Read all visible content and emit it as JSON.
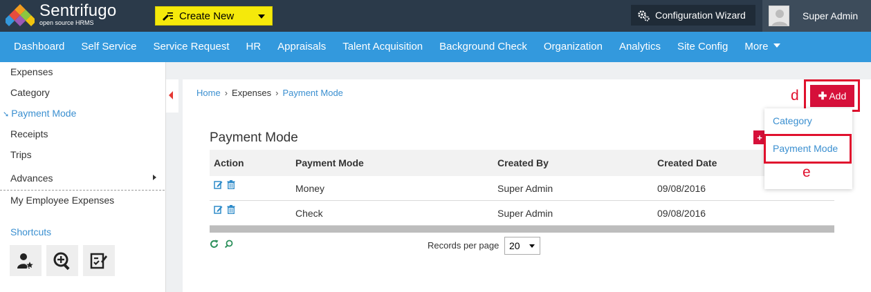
{
  "brand": {
    "name": "Sentrifugo",
    "subtitle": "open source HRMS"
  },
  "topbar": {
    "create_new_label": "Create New",
    "config_wizard_label": "Configuration Wizard",
    "user_name": "Super Admin"
  },
  "nav": {
    "items": [
      "Dashboard",
      "Self Service",
      "Service Request",
      "HR",
      "Appraisals",
      "Talent Acquisition",
      "Background Check",
      "Organization",
      "Analytics",
      "Site Config"
    ],
    "more_label": "More"
  },
  "sidebar": {
    "items": [
      {
        "label": "Expenses"
      },
      {
        "label": "Category"
      },
      {
        "label": "Payment Mode"
      },
      {
        "label": "Receipts"
      },
      {
        "label": "Trips"
      },
      {
        "label": "Advances"
      },
      {
        "label": "My Employee Expenses"
      }
    ],
    "shortcuts_label": "Shortcuts"
  },
  "breadcrumb": {
    "home": "Home",
    "section": "Expenses",
    "current": "Payment Mode",
    "separator": "›"
  },
  "page": {
    "heading": "Payment Mode"
  },
  "table": {
    "headers": [
      "Action",
      "Payment Mode",
      "Created By",
      "Created Date"
    ],
    "rows": [
      {
        "payment_mode": "Money",
        "created_by": "Super Admin",
        "created_date": "09/08/2016"
      },
      {
        "payment_mode": "Check",
        "created_by": "Super Admin",
        "created_date": "09/08/2016"
      }
    ]
  },
  "pagination": {
    "records_per_page_label": "Records per page",
    "records_per_page_value": "20"
  },
  "add_menu": {
    "add_label": "Add",
    "items": [
      "Category",
      "Payment Mode"
    ]
  },
  "annotations": {
    "d": "d",
    "e": "e"
  },
  "colors": {
    "topbar": "#2b3a4a",
    "navbar": "#3399dd",
    "create_new": "#f5e90b",
    "add_button": "#d6103a",
    "highlight": "#e0102d",
    "link": "#3a8fd0"
  }
}
